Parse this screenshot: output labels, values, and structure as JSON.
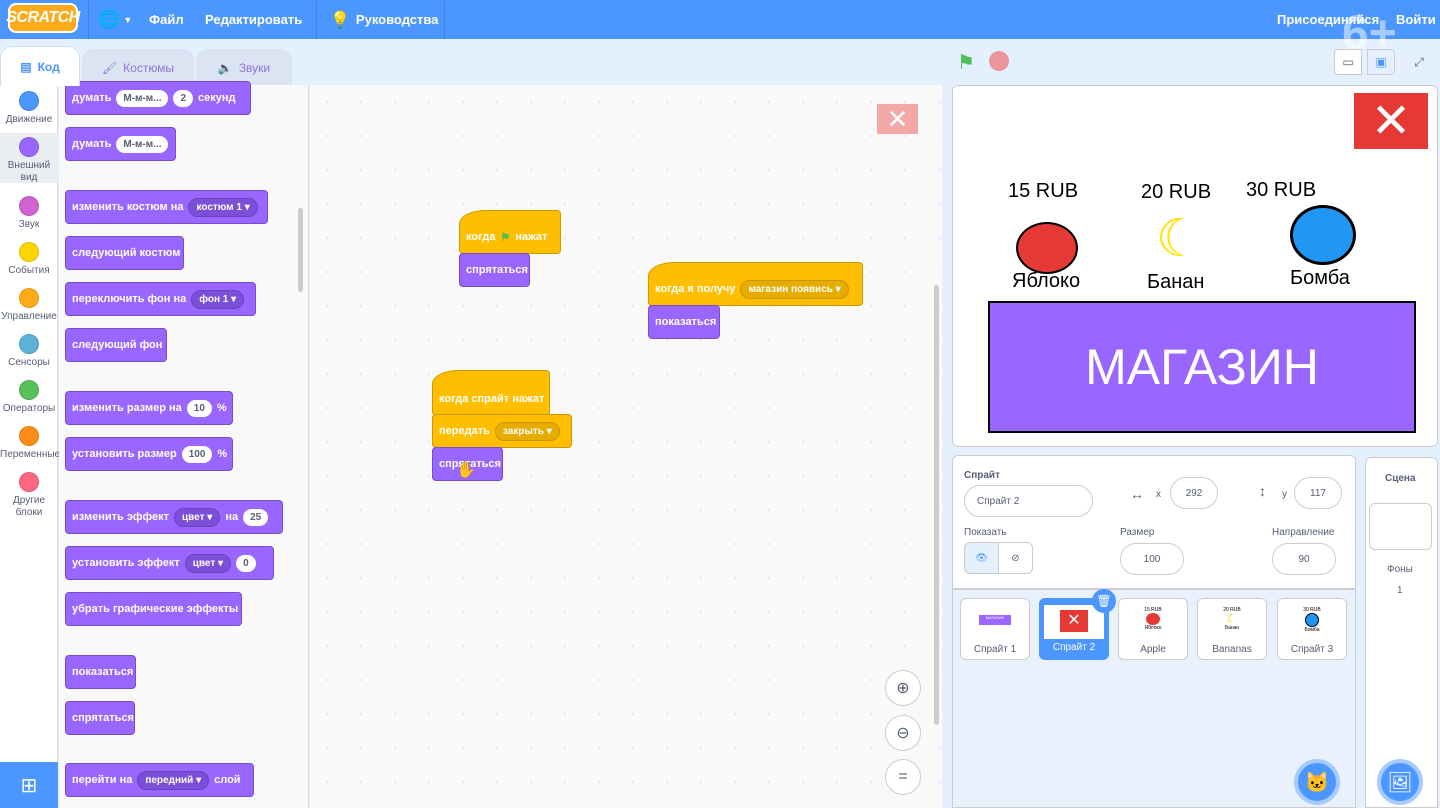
{
  "menubar": {
    "logo": "SCRATCH",
    "file": "Файл",
    "edit": "Редактировать",
    "tutorials": "Руководства",
    "join": "Присоединяйся",
    "signin": "Войти"
  },
  "tabs": {
    "code": "Код",
    "costumes": "Костюмы",
    "sounds": "Звуки"
  },
  "categories": [
    {
      "label": "Движение",
      "color": "#4c97ff"
    },
    {
      "label": "Внешний вид",
      "color": "#9966ff"
    },
    {
      "label": "Звук",
      "color": "#cf63cf"
    },
    {
      "label": "События",
      "color": "#ffd500"
    },
    {
      "label": "Управление",
      "color": "#ffab19"
    },
    {
      "label": "Сенсоры",
      "color": "#5cb1d6"
    },
    {
      "label": "Операторы",
      "color": "#59c059"
    },
    {
      "label": "Переменные",
      "color": "#ff8c1a"
    },
    {
      "label": "Другие блоки",
      "color": "#ff6680"
    }
  ],
  "palette": {
    "think_secs": {
      "word": "думать",
      "msg": "М-м-м...",
      "num": "2",
      "unit": "секунд"
    },
    "think": {
      "word": "думать",
      "msg": "М-м-м..."
    },
    "switch_costume": {
      "text": "изменить костюм на",
      "val": "костюм 1"
    },
    "next_costume": "следующий костюм",
    "switch_backdrop": {
      "text": "переключить фон на",
      "val": "фон 1"
    },
    "next_backdrop": "следующий фон",
    "change_size": {
      "text": "изменить размер на",
      "val": "10",
      "unit": "%"
    },
    "set_size": {
      "text": "установить размер",
      "val": "100",
      "unit": "%"
    },
    "change_effect": {
      "text": "изменить эффект",
      "val": "цвет",
      "on": "на",
      "num": "25"
    },
    "set_effect": {
      "text": "установить эффект",
      "val": "цвет",
      "num": "0"
    },
    "clear_effects": "убрать графические эффекты",
    "show": "показаться",
    "hide": "спрятаться",
    "go_layer": {
      "text": "перейти на",
      "val": "передний",
      "unit": "слой"
    }
  },
  "scripts": {
    "s1": {
      "hat_a": "когда",
      "hat_b": "нажат",
      "cmd": "спрятаться"
    },
    "s2": {
      "hat": "когда я получу",
      "val": "магазин появись",
      "cmd": "показаться"
    },
    "s3": {
      "hat": "когда спрайт нажат",
      "broadcast": "передать",
      "val": "закрыть",
      "cmd": "спрятаться"
    }
  },
  "stage": {
    "items": [
      {
        "price": "15 RUB",
        "name": "Яблоко"
      },
      {
        "price": "20 RUB",
        "name": "Банан"
      },
      {
        "price": "30 RUB",
        "name": "Бомба"
      }
    ],
    "shop": "МАГАЗИН"
  },
  "age_badge": "6+",
  "sprite_info": {
    "title": "Спрайт",
    "name": "Спрайт 2",
    "x_label": "x",
    "x": "292",
    "y_label": "y",
    "y": "117",
    "show_label": "Показать",
    "size_label": "Размер",
    "size": "100",
    "dir_label": "Направление",
    "dir": "90"
  },
  "sprites": [
    {
      "name": "Спрайт 1",
      "selected": false
    },
    {
      "name": "Спрайт 2",
      "selected": true
    },
    {
      "name": "Apple",
      "selected": false
    },
    {
      "name": "Bananas",
      "selected": false
    },
    {
      "name": "Спрайт 3",
      "selected": false
    }
  ],
  "thumb_texts": {
    "shop": "МАГАЗИН",
    "apple_price": "15 RUB",
    "apple": "Яблоко",
    "banana_price": "20 RUB",
    "banana": "Банан",
    "bomb_price": "30 RUB",
    "bomb": "Бомба"
  },
  "scene": {
    "title": "Сцена",
    "backdrops_label": "Фоны",
    "backdrops": "1"
  }
}
